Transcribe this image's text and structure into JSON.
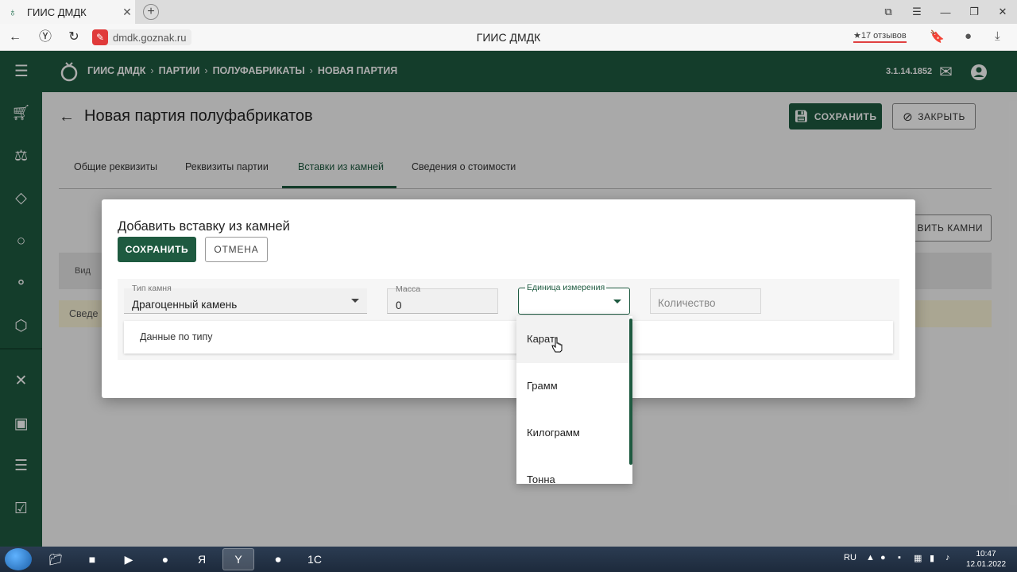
{
  "browser": {
    "tab_title": "ГИИС ДМДК",
    "url": "dmdk.goznak.ru",
    "page_title": "ГИИС ДМДК",
    "reviews": "★17 отзывов"
  },
  "header": {
    "breadcrumbs": [
      "ГИИС ДМДК",
      "ПАРТИИ",
      "ПОЛУФАБРИКАТЫ",
      "НОВАЯ ПАРТИЯ"
    ],
    "version": "3.1.14.1852"
  },
  "page": {
    "title": "Новая партия полуфабрикатов",
    "save_label": "СОХРАНИТЬ",
    "close_label": "ЗАКРЫТЬ",
    "tabs": [
      "Общие реквизиты",
      "Реквизиты партии",
      "Вставки из камней",
      "Сведения о стоимости"
    ],
    "active_tab": "Вставки из камней",
    "add_stones_label": "ВИТЬ КАМНИ",
    "table_header": "Вид",
    "info_text": "Сведе"
  },
  "dialog": {
    "title": "Добавить вставку из камней",
    "save_label": "СОХРАНИТЬ",
    "cancel_label": "ОТМЕНА",
    "stone_type": {
      "label": "Тип камня",
      "value": "Драгоценный камень"
    },
    "mass": {
      "label": "Масса",
      "value": "0"
    },
    "unit": {
      "label": "Единица измерения",
      "value": ""
    },
    "quantity": {
      "placeholder": "Количество"
    },
    "type_data_label": "Данные по типу"
  },
  "unit_dropdown": {
    "options": [
      "Карат",
      "Грамм",
      "Килограмм",
      "Тонна"
    ],
    "hovered": "Карат"
  },
  "taskbar": {
    "lang": "RU",
    "time": "10:47",
    "date": "12.01.2022"
  },
  "colors": {
    "brand": "#1e5a40",
    "info_bg": "#fbf5d8"
  }
}
